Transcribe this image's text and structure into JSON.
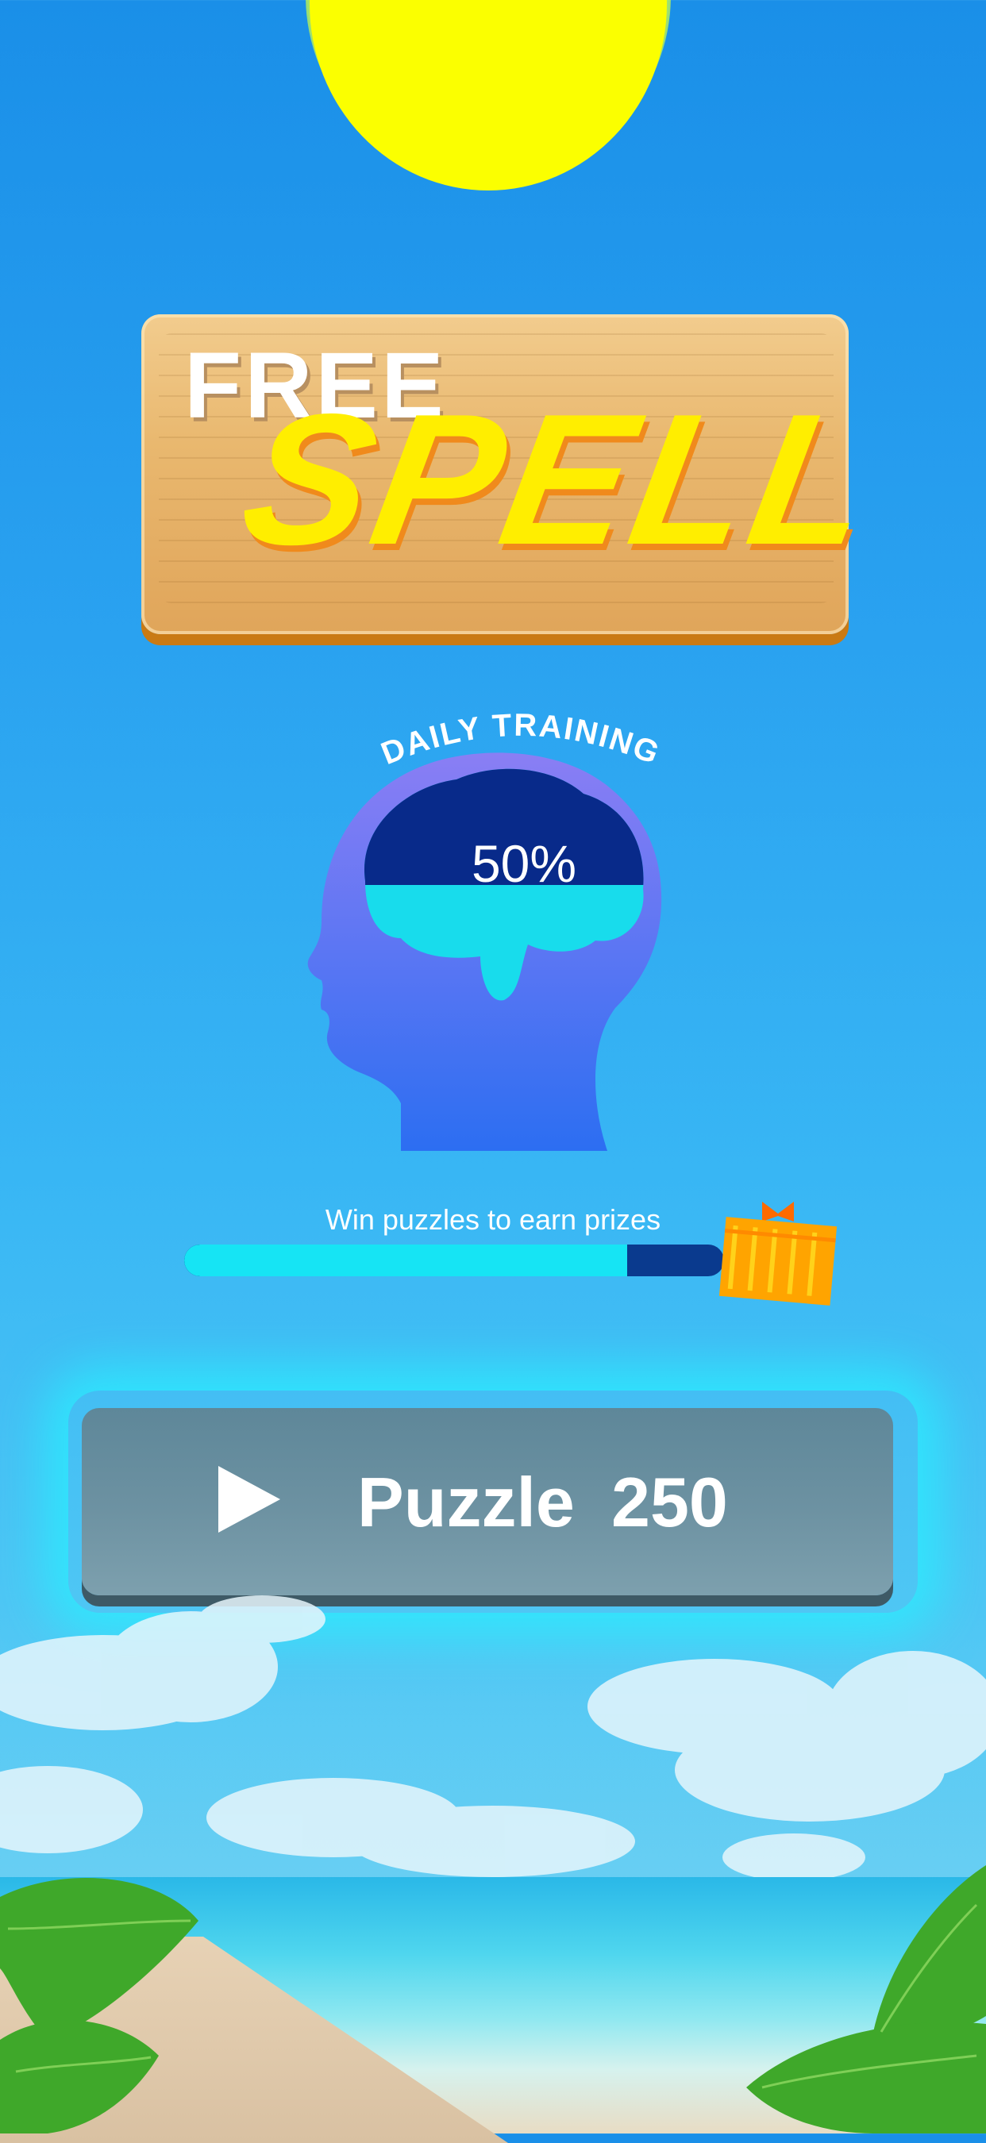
{
  "title": {
    "line1": "FREE",
    "line2": "SPELL"
  },
  "daily_training": {
    "label": "DAILY TRAINING",
    "percent_text": "50%",
    "percent_value": 0.5
  },
  "prizes": {
    "label": "Win puzzles to earn prizes",
    "progress": 0.82
  },
  "play": {
    "word": "Puzzle",
    "number": "250"
  },
  "colors": {
    "sun": "#fbff00",
    "spell": "#ffee00",
    "brain_dark": "#082a8a",
    "brain_light": "#18dcec",
    "head": "#3f7af2"
  }
}
